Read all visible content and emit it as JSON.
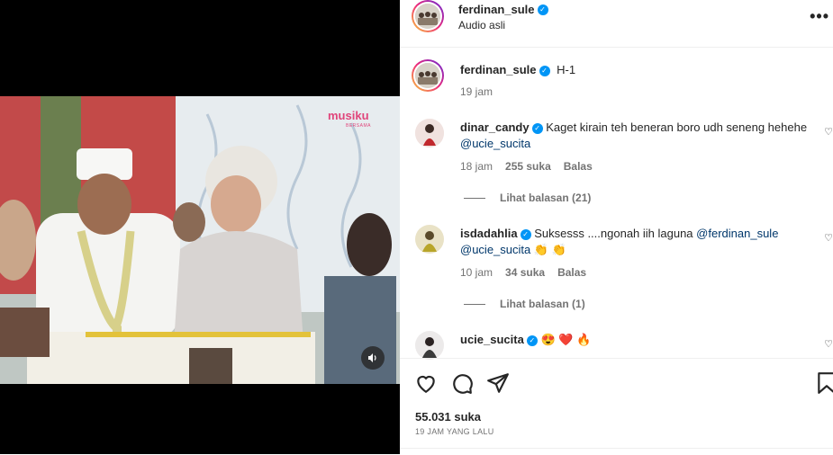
{
  "media": {
    "brand": "musiku",
    "brand_sub": "BERSAMA"
  },
  "header": {
    "username": "ferdinan_sule",
    "subtitle": "Audio asli",
    "more": "•••"
  },
  "caption": {
    "username": "ferdinan_sule",
    "text": "H-1",
    "time": "19 jam"
  },
  "comments": [
    {
      "username": "dinar_candy",
      "text": "Kaget kirain teh beneran boro udh seneng hehehe",
      "mention": "@ucie_sucita",
      "time": "18 jam",
      "likes": "255 suka",
      "reply": "Balas",
      "view_replies": "Lihat balasan (21)"
    },
    {
      "username": "isdadahlia",
      "text": "Suksesss ....ngonah iih laguna",
      "mention": "@ferdinan_sule",
      "mention2": "@ucie_sucita",
      "emoji": "👏 👏",
      "time": "10 jam",
      "likes": "34 suka",
      "reply": "Balas",
      "view_replies": "Lihat balasan (1)"
    },
    {
      "username": "ucie_sucita",
      "emoji": "😍 ❤️ 🔥"
    }
  ],
  "footer": {
    "likes": "55.031 suka",
    "time_ago": "19 JAM YANG LALU"
  },
  "colors": {
    "verified": "#0095f6",
    "mention": "#00376b",
    "secondary": "#737373"
  }
}
